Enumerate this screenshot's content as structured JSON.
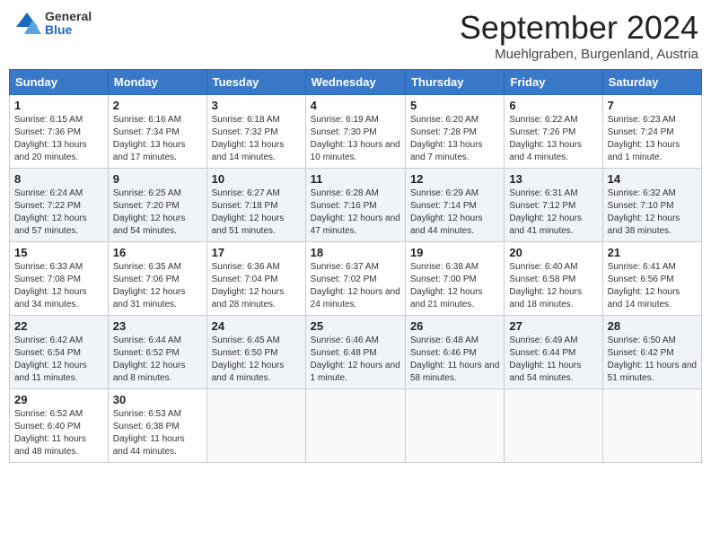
{
  "header": {
    "logo": {
      "general": "General",
      "blue": "Blue"
    },
    "title": "September 2024",
    "location": "Muehlgraben, Burgenland, Austria"
  },
  "calendar": {
    "columns": [
      "Sunday",
      "Monday",
      "Tuesday",
      "Wednesday",
      "Thursday",
      "Friday",
      "Saturday"
    ],
    "weeks": [
      [
        {
          "day": "",
          "empty": true
        },
        {
          "day": "",
          "empty": true
        },
        {
          "day": "",
          "empty": true
        },
        {
          "day": "",
          "empty": true
        },
        {
          "day": "",
          "empty": true
        },
        {
          "day": "",
          "empty": true
        },
        {
          "day": "",
          "empty": true
        }
      ],
      [
        {
          "day": "1",
          "sunrise": "Sunrise: 6:15 AM",
          "sunset": "Sunset: 7:36 PM",
          "daylight": "Daylight: 13 hours and 20 minutes."
        },
        {
          "day": "2",
          "sunrise": "Sunrise: 6:16 AM",
          "sunset": "Sunset: 7:34 PM",
          "daylight": "Daylight: 13 hours and 17 minutes."
        },
        {
          "day": "3",
          "sunrise": "Sunrise: 6:18 AM",
          "sunset": "Sunset: 7:32 PM",
          "daylight": "Daylight: 13 hours and 14 minutes."
        },
        {
          "day": "4",
          "sunrise": "Sunrise: 6:19 AM",
          "sunset": "Sunset: 7:30 PM",
          "daylight": "Daylight: 13 hours and 10 minutes."
        },
        {
          "day": "5",
          "sunrise": "Sunrise: 6:20 AM",
          "sunset": "Sunset: 7:28 PM",
          "daylight": "Daylight: 13 hours and 7 minutes."
        },
        {
          "day": "6",
          "sunrise": "Sunrise: 6:22 AM",
          "sunset": "Sunset: 7:26 PM",
          "daylight": "Daylight: 13 hours and 4 minutes."
        },
        {
          "day": "7",
          "sunrise": "Sunrise: 6:23 AM",
          "sunset": "Sunset: 7:24 PM",
          "daylight": "Daylight: 13 hours and 1 minute."
        }
      ],
      [
        {
          "day": "8",
          "sunrise": "Sunrise: 6:24 AM",
          "sunset": "Sunset: 7:22 PM",
          "daylight": "Daylight: 12 hours and 57 minutes."
        },
        {
          "day": "9",
          "sunrise": "Sunrise: 6:25 AM",
          "sunset": "Sunset: 7:20 PM",
          "daylight": "Daylight: 12 hours and 54 minutes."
        },
        {
          "day": "10",
          "sunrise": "Sunrise: 6:27 AM",
          "sunset": "Sunset: 7:18 PM",
          "daylight": "Daylight: 12 hours and 51 minutes."
        },
        {
          "day": "11",
          "sunrise": "Sunrise: 6:28 AM",
          "sunset": "Sunset: 7:16 PM",
          "daylight": "Daylight: 12 hours and 47 minutes."
        },
        {
          "day": "12",
          "sunrise": "Sunrise: 6:29 AM",
          "sunset": "Sunset: 7:14 PM",
          "daylight": "Daylight: 12 hours and 44 minutes."
        },
        {
          "day": "13",
          "sunrise": "Sunrise: 6:31 AM",
          "sunset": "Sunset: 7:12 PM",
          "daylight": "Daylight: 12 hours and 41 minutes."
        },
        {
          "day": "14",
          "sunrise": "Sunrise: 6:32 AM",
          "sunset": "Sunset: 7:10 PM",
          "daylight": "Daylight: 12 hours and 38 minutes."
        }
      ],
      [
        {
          "day": "15",
          "sunrise": "Sunrise: 6:33 AM",
          "sunset": "Sunset: 7:08 PM",
          "daylight": "Daylight: 12 hours and 34 minutes."
        },
        {
          "day": "16",
          "sunrise": "Sunrise: 6:35 AM",
          "sunset": "Sunset: 7:06 PM",
          "daylight": "Daylight: 12 hours and 31 minutes."
        },
        {
          "day": "17",
          "sunrise": "Sunrise: 6:36 AM",
          "sunset": "Sunset: 7:04 PM",
          "daylight": "Daylight: 12 hours and 28 minutes."
        },
        {
          "day": "18",
          "sunrise": "Sunrise: 6:37 AM",
          "sunset": "Sunset: 7:02 PM",
          "daylight": "Daylight: 12 hours and 24 minutes."
        },
        {
          "day": "19",
          "sunrise": "Sunrise: 6:38 AM",
          "sunset": "Sunset: 7:00 PM",
          "daylight": "Daylight: 12 hours and 21 minutes."
        },
        {
          "day": "20",
          "sunrise": "Sunrise: 6:40 AM",
          "sunset": "Sunset: 6:58 PM",
          "daylight": "Daylight: 12 hours and 18 minutes."
        },
        {
          "day": "21",
          "sunrise": "Sunrise: 6:41 AM",
          "sunset": "Sunset: 6:56 PM",
          "daylight": "Daylight: 12 hours and 14 minutes."
        }
      ],
      [
        {
          "day": "22",
          "sunrise": "Sunrise: 6:42 AM",
          "sunset": "Sunset: 6:54 PM",
          "daylight": "Daylight: 12 hours and 11 minutes."
        },
        {
          "day": "23",
          "sunrise": "Sunrise: 6:44 AM",
          "sunset": "Sunset: 6:52 PM",
          "daylight": "Daylight: 12 hours and 8 minutes."
        },
        {
          "day": "24",
          "sunrise": "Sunrise: 6:45 AM",
          "sunset": "Sunset: 6:50 PM",
          "daylight": "Daylight: 12 hours and 4 minutes."
        },
        {
          "day": "25",
          "sunrise": "Sunrise: 6:46 AM",
          "sunset": "Sunset: 6:48 PM",
          "daylight": "Daylight: 12 hours and 1 minute."
        },
        {
          "day": "26",
          "sunrise": "Sunrise: 6:48 AM",
          "sunset": "Sunset: 6:46 PM",
          "daylight": "Daylight: 11 hours and 58 minutes."
        },
        {
          "day": "27",
          "sunrise": "Sunrise: 6:49 AM",
          "sunset": "Sunset: 6:44 PM",
          "daylight": "Daylight: 11 hours and 54 minutes."
        },
        {
          "day": "28",
          "sunrise": "Sunrise: 6:50 AM",
          "sunset": "Sunset: 6:42 PM",
          "daylight": "Daylight: 11 hours and 51 minutes."
        }
      ],
      [
        {
          "day": "29",
          "sunrise": "Sunrise: 6:52 AM",
          "sunset": "Sunset: 6:40 PM",
          "daylight": "Daylight: 11 hours and 48 minutes."
        },
        {
          "day": "30",
          "sunrise": "Sunrise: 6:53 AM",
          "sunset": "Sunset: 6:38 PM",
          "daylight": "Daylight: 11 hours and 44 minutes."
        },
        {
          "day": "",
          "empty": true
        },
        {
          "day": "",
          "empty": true
        },
        {
          "day": "",
          "empty": true
        },
        {
          "day": "",
          "empty": true
        },
        {
          "day": "",
          "empty": true
        }
      ]
    ]
  }
}
